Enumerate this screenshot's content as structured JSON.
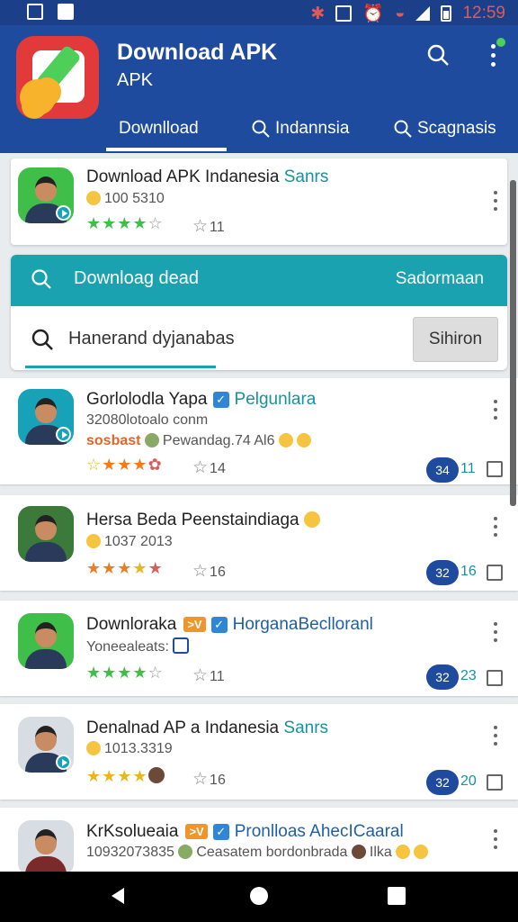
{
  "status_bar": {
    "time": "12:59"
  },
  "app": {
    "title": "Download APK",
    "subtitle": "APK",
    "tabs": [
      {
        "label": "Downlload",
        "active": true
      },
      {
        "label": "Indannsia"
      },
      {
        "label": "Scagnasis"
      }
    ]
  },
  "featured": {
    "title": "Download APK Indanesia",
    "tag": "Sanrs",
    "meta": "100 5310",
    "rating_stars": 4,
    "count": "11"
  },
  "search": {
    "bar_label": "Downloag dead",
    "bar_right": "Sadormaan",
    "field_value": "Hanerand dyjanabas",
    "button_label": "Sihiron"
  },
  "items": [
    {
      "title": "Gorlolodla Yapa",
      "tag": "Pelgunlara",
      "sub1": "32080lotoalo conm",
      "sub2": "Pewandag.74 Al6",
      "badge": "sosbast",
      "stars": 3,
      "count": "14",
      "pill": "34",
      "pcount": "11"
    },
    {
      "title": "Hersa Beda Peenstaindiaga",
      "sub": "1037 2013",
      "stars": 3,
      "count": "16",
      "pill": "32",
      "pcount": "16"
    },
    {
      "title": "Downloraka",
      "badge": ">V",
      "tag": "HorganaBeclloranl",
      "sub": "Yoneealeats:",
      "stars": 4,
      "count": "11",
      "pill": "32",
      "pcount": "23"
    },
    {
      "title": "Denalnad AP a  Indanesia",
      "tag": "Sanrs",
      "sub": "1013.3319",
      "stars": 4,
      "count": "16",
      "pill": "32",
      "pcount": "20"
    },
    {
      "title": "KrKsolueaia",
      "badge": ">V",
      "tag": "Pronlloas AhecICaaral",
      "sub": "10932073835",
      "sub2": "Ceasatem bordonbrada",
      "sub3": "Ilka"
    }
  ],
  "colors": {
    "primary": "#1e4b9e",
    "accent": "#1aa2b0",
    "star_green": "#3fbf4a",
    "star_orange": "#f07c1e"
  }
}
